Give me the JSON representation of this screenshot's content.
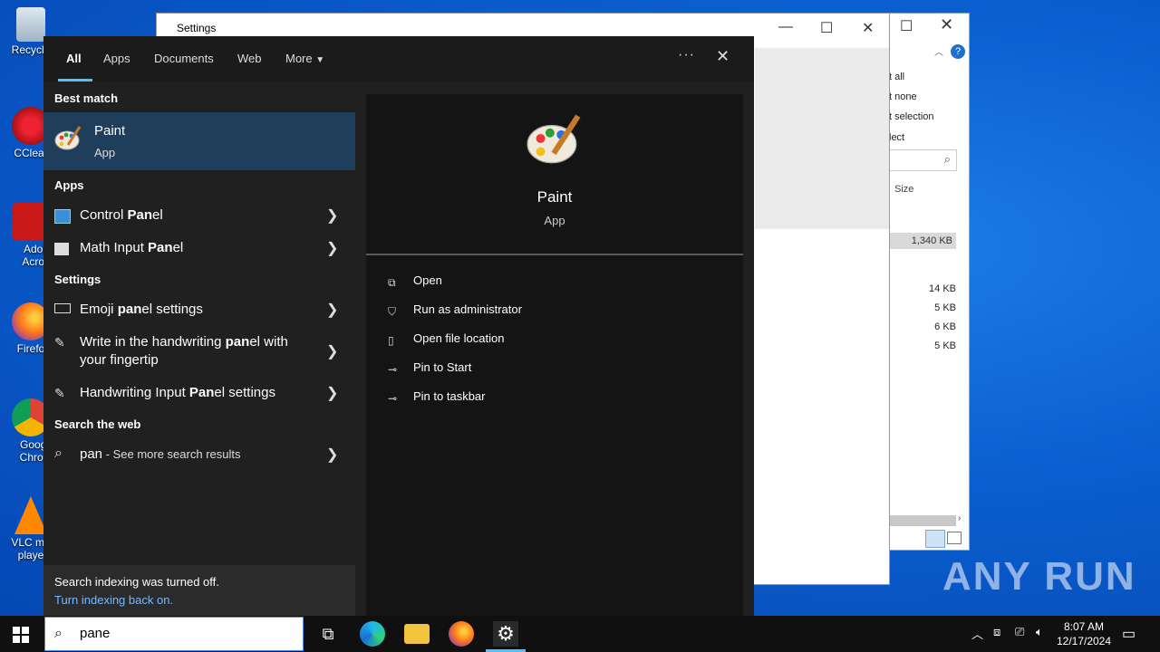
{
  "desktop": {
    "icons": [
      {
        "label": "Recycle"
      },
      {
        "label": "CClear"
      },
      {
        "label": "Adob Acrob"
      },
      {
        "label": "Firefo"
      },
      {
        "label": "Googl Chron"
      },
      {
        "label": "VLC me playe"
      }
    ]
  },
  "settings_window": {
    "title": "Settings"
  },
  "explorer_window": {
    "menu": [
      "t all",
      "t none",
      "t selection",
      "lect"
    ],
    "column": "Size",
    "sizes": [
      "1,340 KB",
      "14 KB",
      "5 KB",
      "6 KB",
      "5 KB"
    ]
  },
  "start_menu": {
    "tabs": [
      "All",
      "Apps",
      "Documents",
      "Web",
      "More"
    ],
    "best_match_header": "Best match",
    "best_match": {
      "title": "Paint",
      "subtitle": "App"
    },
    "apps_header": "Apps",
    "apps": [
      {
        "pre": "Control ",
        "bold": "Pan",
        "post": "el"
      },
      {
        "pre": "Math Input ",
        "bold": "Pan",
        "post": "el"
      }
    ],
    "settings_header": "Settings",
    "settings": [
      {
        "pre": "Emoji ",
        "bold": "pan",
        "post": "el settings"
      },
      {
        "pre": "Write in the handwriting ",
        "bold": "pan",
        "post": "el with",
        "line2": "your fingertip"
      },
      {
        "pre": "Handwriting Input ",
        "bold": "Pan",
        "post": "el settings"
      }
    ],
    "web_header": "Search the web",
    "web_item": {
      "query": "pan",
      "suffix": " - See more search results"
    },
    "footer": {
      "line1": "Search indexing was turned off.",
      "line2": "Turn indexing back on."
    },
    "preview": {
      "title": "Paint",
      "subtitle": "App",
      "actions": [
        "Open",
        "Run as administrator",
        "Open file location",
        "Pin to Start",
        "Pin to taskbar"
      ]
    }
  },
  "taskbar": {
    "search_value": "pane",
    "time": "8:07 AM",
    "date": "12/17/2024"
  },
  "watermark": "ANY RUN"
}
